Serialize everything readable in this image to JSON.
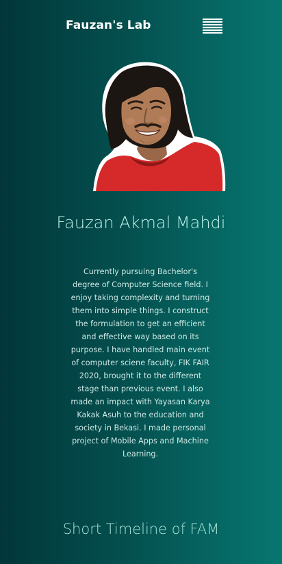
{
  "header": {
    "brand": "Fauzan's Lab",
    "menu_icon": "hamburger-menu-icon"
  },
  "profile": {
    "photo_alt": "Fauzan Akmal Mahdi",
    "name": "Fauzan Akmal Mahdi",
    "bio": "Currently pursuing Bachelor's degree of Computer Science field. I enjoy taking complexity and turning them into simple things. I construct the formulation to get an efficient and effective way based on its purpose. I have handled main event of computer sciene faculty, FIK FAIR 2020, brought it to the different stage than previous event. I also made an impact with Yayasan Karya Kakak Asuh to the education and society in Bekasi. I made personal project of Mobile Apps and Machine Learning."
  },
  "timeline": {
    "title": "Short Timeline of FAM"
  },
  "colors": {
    "background_start": "#02363a",
    "background_end": "#077670",
    "name_text": "#bff3ea",
    "shirt": "#d62a2a"
  }
}
